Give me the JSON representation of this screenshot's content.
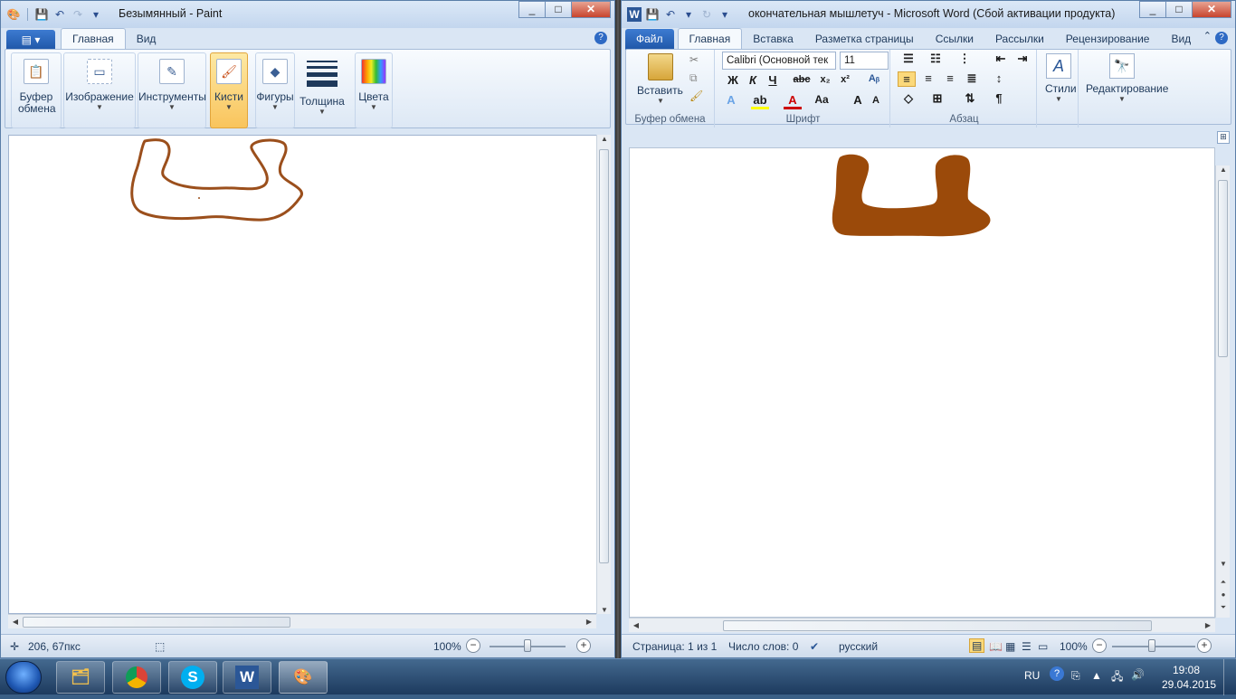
{
  "paint": {
    "title": "Безымянный - Paint",
    "menu_label": "▤ ▾",
    "tabs": [
      "Главная",
      "Вид"
    ],
    "groups": [
      {
        "label": "Буфер обмена",
        "icon": "clipboard-icon"
      },
      {
        "label": "Изображение",
        "icon": "select-icon"
      },
      {
        "label": "Инструменты",
        "icon": "tools-icon"
      },
      {
        "label": "Кисти",
        "icon": "brush-icon"
      },
      {
        "label": "Фигуры",
        "icon": "shapes-icon"
      },
      {
        "label": "Толщина",
        "icon": "thickness-icon"
      },
      {
        "label": "Цвета",
        "icon": "colors-icon"
      }
    ],
    "status": {
      "coords": "206, 67пкс",
      "zoom": "100%"
    },
    "stroke_color": "#9b4f1c"
  },
  "word": {
    "title": "окончательная мышлетуч  -  Microsoft Word (Сбой активации продукта)",
    "file_tab": "Файл",
    "tabs": [
      "Главная",
      "Вставка",
      "Разметка страницы",
      "Ссылки",
      "Рассылки",
      "Рецензирование",
      "Вид"
    ],
    "clipboard": {
      "paste": "Вставить",
      "group": "Буфер обмена"
    },
    "font": {
      "name": "Calibri (Основной тек",
      "size": "11",
      "group": "Шрифт"
    },
    "paragraph": {
      "group": "Абзац"
    },
    "styles": "Стили",
    "editing": "Редактирование",
    "status": {
      "page": "Страница: 1 из 1",
      "words": "Число слов: 0",
      "lang": "русский",
      "zoom": "100%"
    },
    "shape_color": "#9b4a0a"
  },
  "taskbar": {
    "lang": "RU",
    "time": "19:08",
    "date": "29.04.2015",
    "apps": [
      "explorer-icon",
      "chrome-icon",
      "skype-icon",
      "word-icon",
      "paint-icon"
    ]
  }
}
